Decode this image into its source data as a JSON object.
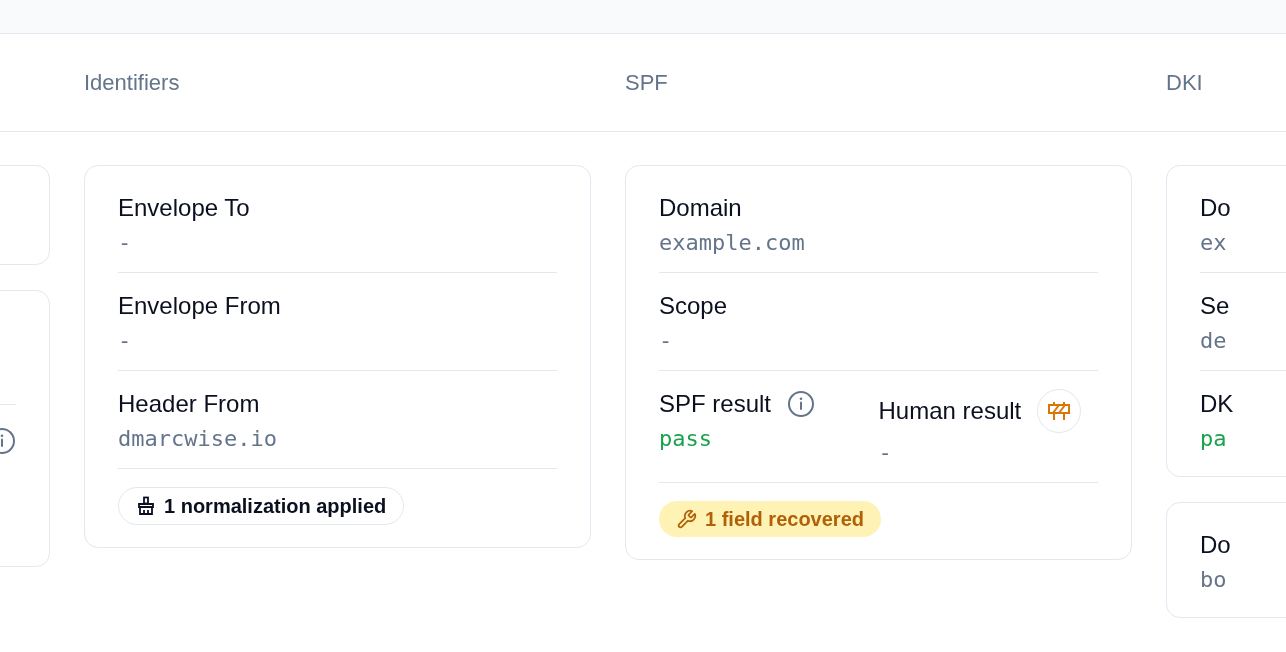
{
  "columns": [
    {
      "title": "Identifiers",
      "cards": [
        {
          "fields": [
            {
              "label": "Envelope To",
              "value": "-"
            },
            {
              "label": "Envelope From",
              "value": "-"
            },
            {
              "label": "Header From",
              "value": "dmarcwise.io"
            }
          ],
          "badge": {
            "kind": "normalization",
            "text": "1 normalization applied"
          }
        }
      ]
    },
    {
      "title": "SPF",
      "cards": [
        {
          "fields": [
            {
              "label": "Domain",
              "value": "example.com"
            },
            {
              "label": "Scope",
              "value": "-"
            },
            {
              "kind": "pair",
              "items": [
                {
                  "kind": "explained",
                  "label": "SPF result",
                  "value": "pass",
                  "color": "#16a34a"
                },
                {
                  "kind": "flagged",
                  "label": "Human result",
                  "value": "-"
                }
              ]
            }
          ],
          "badge": {
            "kind": "recovered",
            "text": "1 field recovered"
          }
        }
      ]
    },
    {
      "title": "DKI",
      "cards": [
        {
          "fields": [
            {
              "label": "Do",
              "value": "ex"
            },
            {
              "label": "Se",
              "value": "de"
            },
            {
              "label": "DK",
              "value": "pa",
              "color": "#16a34a"
            }
          ]
        },
        {
          "fields": [
            {
              "label": "Do",
              "value": "bo"
            }
          ]
        }
      ]
    }
  ]
}
